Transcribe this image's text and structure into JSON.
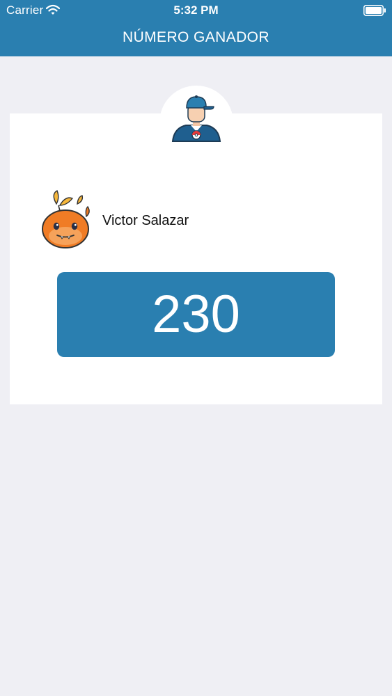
{
  "status_bar": {
    "carrier": "Carrier",
    "time": "5:32 PM"
  },
  "nav": {
    "title": "NÚMERO GANADOR"
  },
  "winner": {
    "avatar_icon": "trainer-avatar-icon",
    "pokemon_icon": "fire-pokemon-icon",
    "name": "Victor Salazar",
    "number": "230"
  },
  "colors": {
    "accent": "#2a7fb0",
    "background": "#efeff4",
    "card": "#ffffff"
  }
}
